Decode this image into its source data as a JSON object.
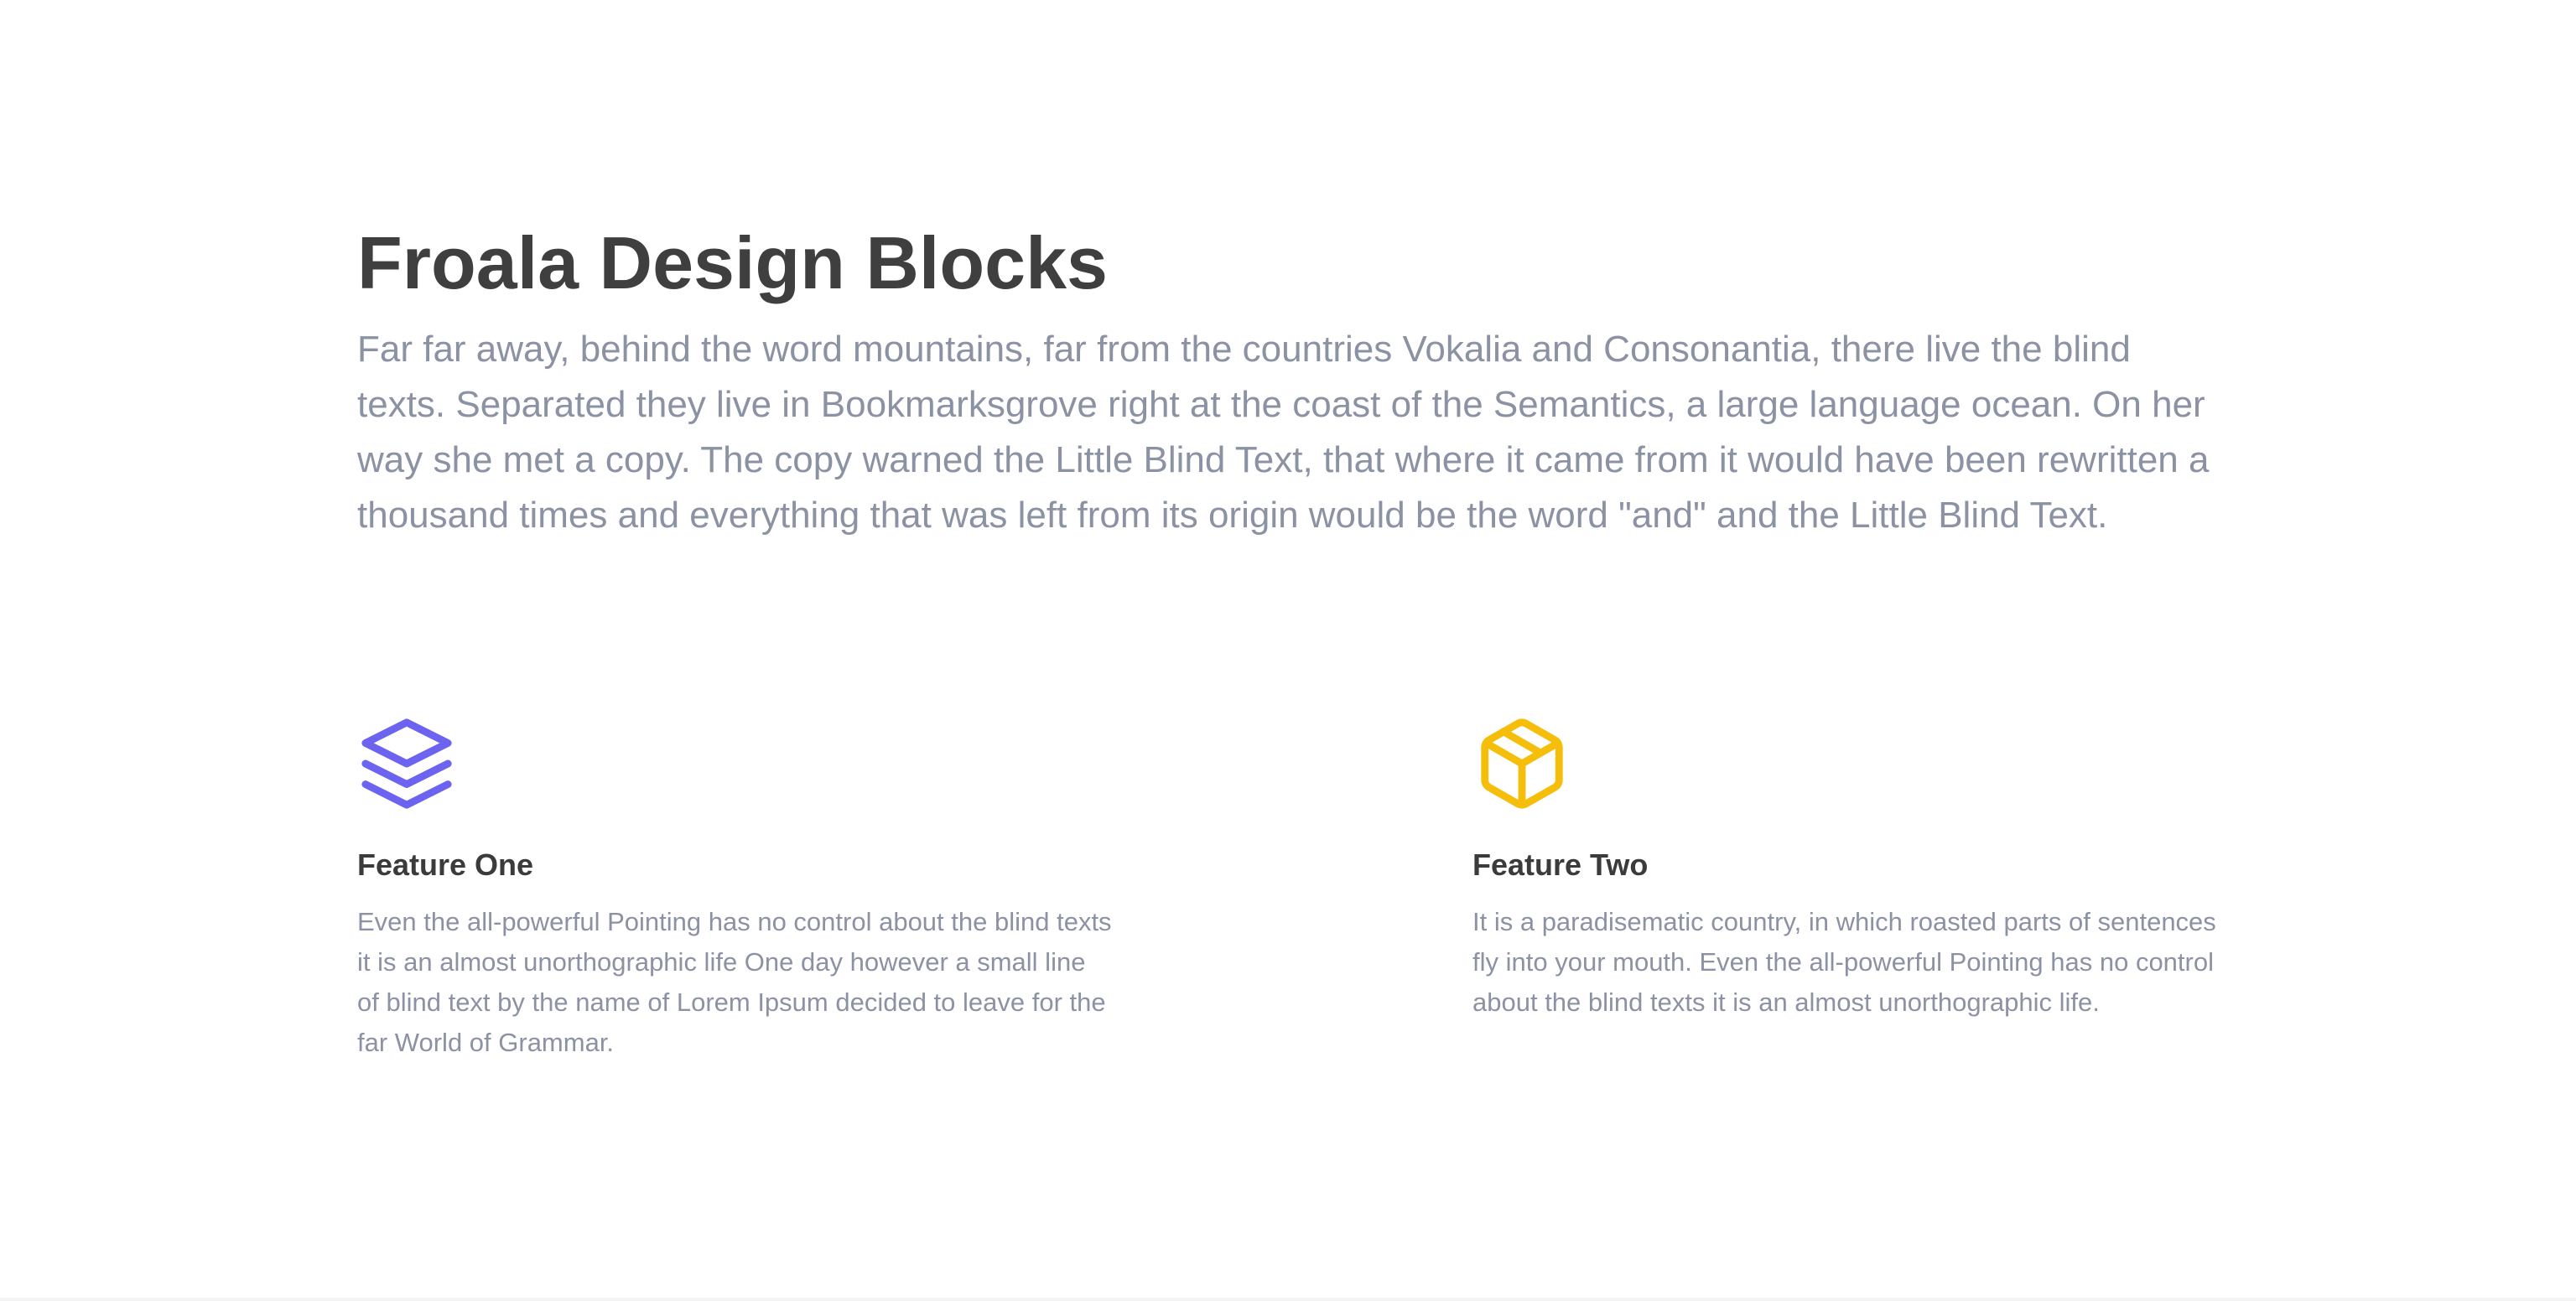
{
  "page": {
    "title": "Froala Design Blocks",
    "lead": "Far far away, behind the word mountains, far from the countries Vokalia and Consonantia, there live the blind texts. Separated they live in Bookmarksgrove right at the coast of the Semantics, a large language ocean. On her way she met a copy. The copy warned the Little Blind Text, that where it came from it would have been rewritten a thousand times and everything that was left from its origin would be the word \"and\" and the Little Blind Text."
  },
  "features": [
    {
      "title": "Feature One",
      "text": "Even the all-powerful Pointing has no control about the blind texts it is an almost unorthographic life One day however a small line of blind text by the name of Lorem Ipsum decided to leave for the far World of Grammar.",
      "icon": "layers-icon",
      "color": "#6c63f0"
    },
    {
      "title": "Feature Two",
      "text": "It is a paradisematic country, in which roasted parts of sentences fly into your mouth. Even the all-powerful Pointing has no control about the blind texts it is an almost unorthographic life.",
      "icon": "package-box-icon",
      "color": "#f5be0b"
    }
  ],
  "colors": {
    "heading": "#3f3f3f",
    "body_text": "#8a92a3",
    "background": "#ffffff"
  }
}
